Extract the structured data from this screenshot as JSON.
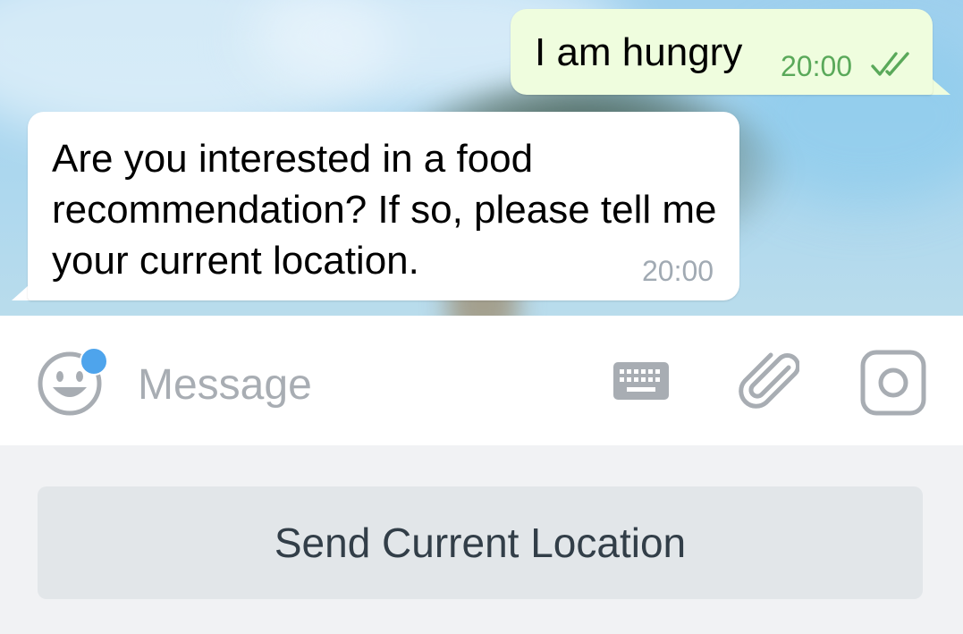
{
  "chat": {
    "messages": [
      {
        "direction": "outgoing",
        "text": "I am hungry",
        "time": "20:00",
        "status_icon": "double-check-icon"
      },
      {
        "direction": "incoming",
        "text": "Are you interested in a food recommendation? If so, please tell me your current location.",
        "time": "20:00"
      }
    ]
  },
  "input_bar": {
    "placeholder": "Message",
    "value": "",
    "icons": [
      "emoji-icon",
      "keyboard-icon",
      "attach-icon",
      "camera-icon"
    ],
    "emoji_badge_color": "#4ea4ec"
  },
  "reply_keyboard": {
    "buttons": [
      {
        "label": "Send Current Location"
      }
    ]
  },
  "colors": {
    "outgoing_bubble": "#effdde",
    "incoming_bubble": "#ffffff",
    "outgoing_time": "#5aa95a",
    "incoming_time": "#a1aab3",
    "icon_gray": "#a8adb3",
    "reply_button_bg": "#e2e6e9",
    "reply_button_text": "#323e48"
  }
}
